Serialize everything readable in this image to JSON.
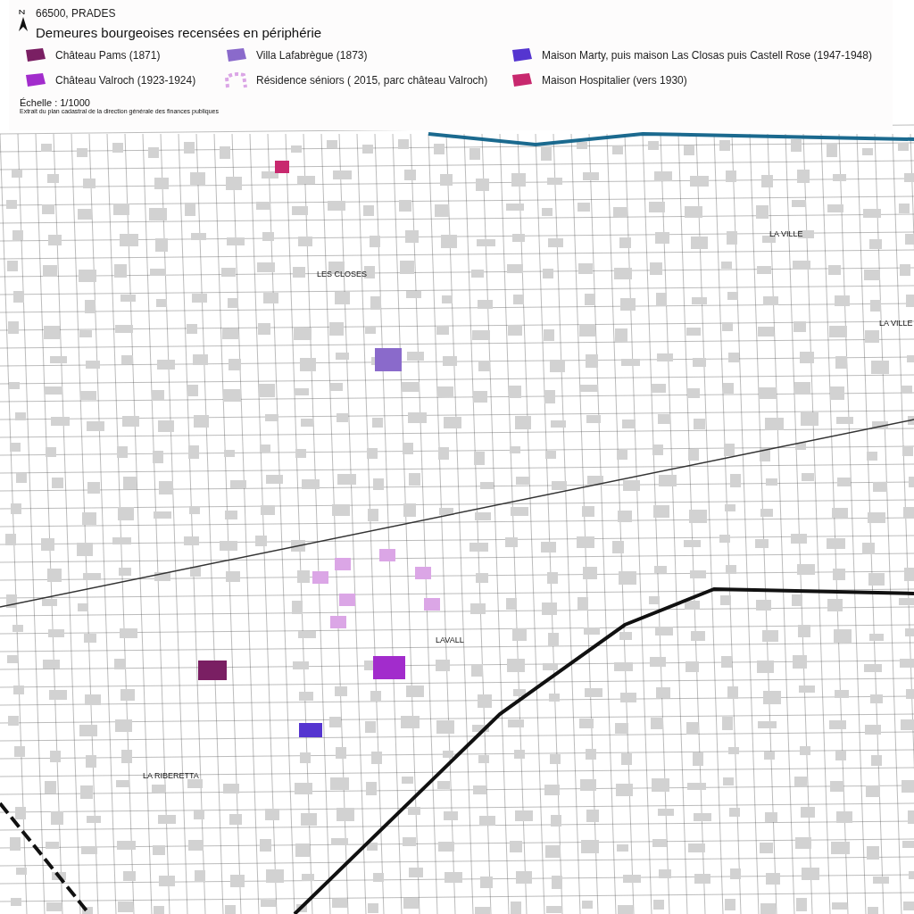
{
  "header": {
    "place": "66500, PRADES",
    "title": "Demeures bourgeoises recensées en périphérie"
  },
  "legend": [
    {
      "label": "Château Pams (1871)",
      "color": "#7a1f63",
      "kind": "block"
    },
    {
      "label": "Villa Lafabrègue (1873)",
      "color": "#8a6acb",
      "kind": "block"
    },
    {
      "label": "Maison Marty, puis maison Las Closas puis Castell Rose (1947-1948)",
      "color": "#5535d0",
      "kind": "block"
    },
    {
      "label": "Château Valroch (1923-1924)",
      "color": "#a22ccc",
      "kind": "block"
    },
    {
      "label": "Résidence séniors ( 2015, parc château Valroch)",
      "color": "#dba6e6",
      "kind": "dashed"
    },
    {
      "label": "Maison Hospitalier (vers 1930)",
      "color": "#c8286e",
      "kind": "block"
    }
  ],
  "scale": "Échelle : 1/1000",
  "source": "Extrait du plan cadastral de la direction générale des finances publiques",
  "map_labels": [
    "LES CLOSES",
    "LA VILLE",
    "LA VILLE",
    "LA RIBERETTA",
    "LAVALL"
  ]
}
